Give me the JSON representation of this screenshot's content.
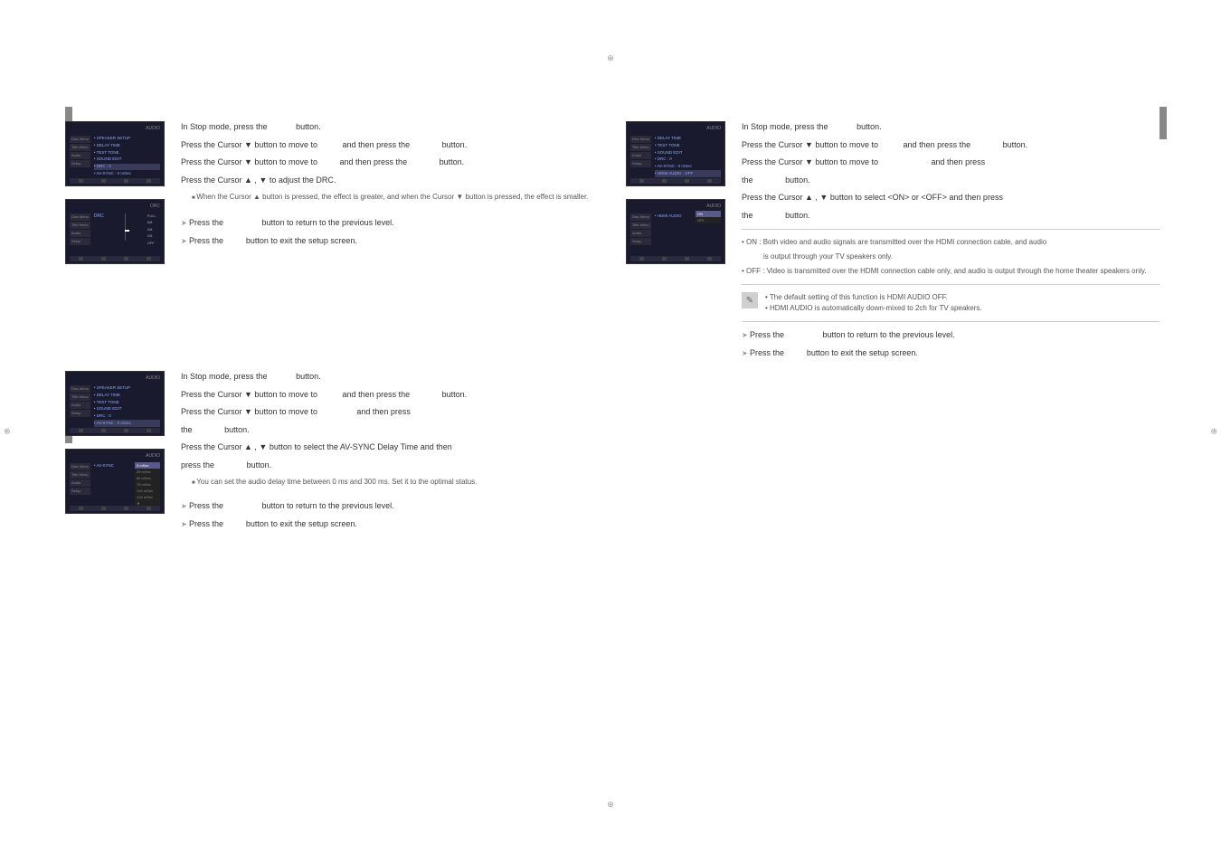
{
  "cropmarks": {
    "symbol": "⊕"
  },
  "drc": {
    "step1": {
      "a": "In Stop mode, press the",
      "b": "button."
    },
    "step2": {
      "a": "Press the Cursor ▼ button to move to",
      "b": "and then press the",
      "c": "button."
    },
    "step3": {
      "a": "Press the Cursor ▼ button to move to",
      "b": "and then press the",
      "c": "button."
    },
    "step4": "Press the Cursor ▲ , ▼ to adjust the DRC.",
    "bullet1": "When the Cursor ▲ button is pressed, the effect is greater, and when the Cursor ▼ button is pressed, the effect is smaller.",
    "ret1": {
      "a": "Press the",
      "b": "button to return to the previous level."
    },
    "ret2": {
      "a": "Press the",
      "b": "button to exit the setup screen."
    }
  },
  "avsync": {
    "step1": {
      "a": "In Stop mode, press the",
      "b": "button."
    },
    "step2": {
      "a": "Press the Cursor ▼ button to move to",
      "b": "and then press the",
      "c": "button."
    },
    "step3": {
      "a": "Press the Cursor ▼ button to move to",
      "b": "and then press"
    },
    "step3b": {
      "a": "the",
      "b": "button."
    },
    "step4": "Press the Cursor ▲ , ▼ button to select the AV-SYNC Delay Time  and then",
    "step4b": {
      "a": "press the",
      "b": "button."
    },
    "bullet1": "You can set the audio delay time between 0 ms and 300 ms. Set it to the optimal status.",
    "ret1": {
      "a": "Press the",
      "b": "button to return to the previous level."
    },
    "ret2": {
      "a": "Press the",
      "b": "button to exit the setup screen."
    }
  },
  "hdmi": {
    "step1": {
      "a": "In Stop mode, press the",
      "b": "button."
    },
    "step2": {
      "a": "Press the Cursor ▼ button to move to",
      "b": "and then press the",
      "c": "button."
    },
    "step3": {
      "a": "Press the Cursor ▼ button to move to",
      "b": "and then press"
    },
    "step3b": {
      "a": "the",
      "b": "button."
    },
    "step4": "Press the Cursor ▲ , ▼ button to select <ON> or <OFF> and then press",
    "step4b": {
      "a": "the",
      "b": "button."
    },
    "on": "• ON : Both video and audio signals are transmitted over the HDMI connection cable, and audio",
    "on2": "is output through your TV speakers only.",
    "off": "• OFF : Video is transmitted over the HDMI connection cable only, and audio is output through the home theater speakers only.",
    "note1": "• The default setting of this function is HDMI AUDIO OFF.",
    "note2": "• HDMI AUDIO is automatically down-mixed to 2ch for TV speakers.",
    "ret1": {
      "a": "Press the",
      "b": "button to return to the previous level."
    },
    "ret2": {
      "a": "Press the",
      "b": "button to exit the setup screen."
    }
  },
  "menus": {
    "drc1": {
      "hdr_l": "",
      "hdr_r": "AUDIO",
      "tabs": [
        "Disc Menu",
        "Title Menu",
        "Audio",
        "Setup"
      ],
      "items": [
        "• SPEAKER SETUP",
        "• DELAY TIME",
        "• TEST TONE",
        "• SOUND EDIT",
        "• DRC                 : 0",
        "• AV-SYNC         : 0 mSec"
      ],
      "sel": 4
    },
    "drc2": {
      "hdr_l": "",
      "hdr_r": "DRC",
      "tabs": [
        "Disc Menu",
        "Title Menu",
        "Audio",
        "Setup"
      ],
      "label_top": "FULL",
      "label_mid": "6/8",
      "label_mid2": "4/8",
      "label_mid3": "2/8",
      "label_bot": "OFF",
      "slider_title": "DRC"
    },
    "av1": {
      "hdr_l": "",
      "hdr_r": "AUDIO",
      "tabs": [
        "Disc Menu",
        "Title Menu",
        "Audio",
        "Setup"
      ],
      "items": [
        "• SPEAKER SETUP",
        "• DELAY TIME",
        "• TEST TONE",
        "• SOUND EDIT",
        "• DRC                 : 0",
        "• AV-SYNC         : 0 mSec"
      ],
      "sel": 5
    },
    "av2": {
      "hdr_l": "",
      "hdr_r": "AUDIO",
      "tabs": [
        "Disc Menu",
        "Title Menu",
        "Audio",
        "Setup"
      ],
      "item": "• AV-SYNC",
      "pop": [
        "0 mSec",
        "25 mSec",
        "50 mSec",
        "75 mSec",
        "100 mSec",
        "125 mSec",
        "▼"
      ]
    },
    "hdmi1": {
      "hdr_l": "",
      "hdr_r": "AUDIO",
      "tabs": [
        "Disc Menu",
        "Title Menu",
        "Audio",
        "Setup"
      ],
      "items": [
        "• DELAY TIME",
        "• TEST TONE",
        "• SOUND EDIT",
        "• DRC                 : 0",
        "• AV-SYNC         : 0 mSec",
        "• HDMI AUDIO   : OFF"
      ],
      "sel": 5
    },
    "hdmi2": {
      "hdr_l": "",
      "hdr_r": "AUDIO",
      "tabs": [
        "Disc Menu",
        "Title Menu",
        "Audio",
        "Setup"
      ],
      "item": "• HDMI AUDIO",
      "pop": [
        "ON",
        "OFF"
      ]
    }
  }
}
